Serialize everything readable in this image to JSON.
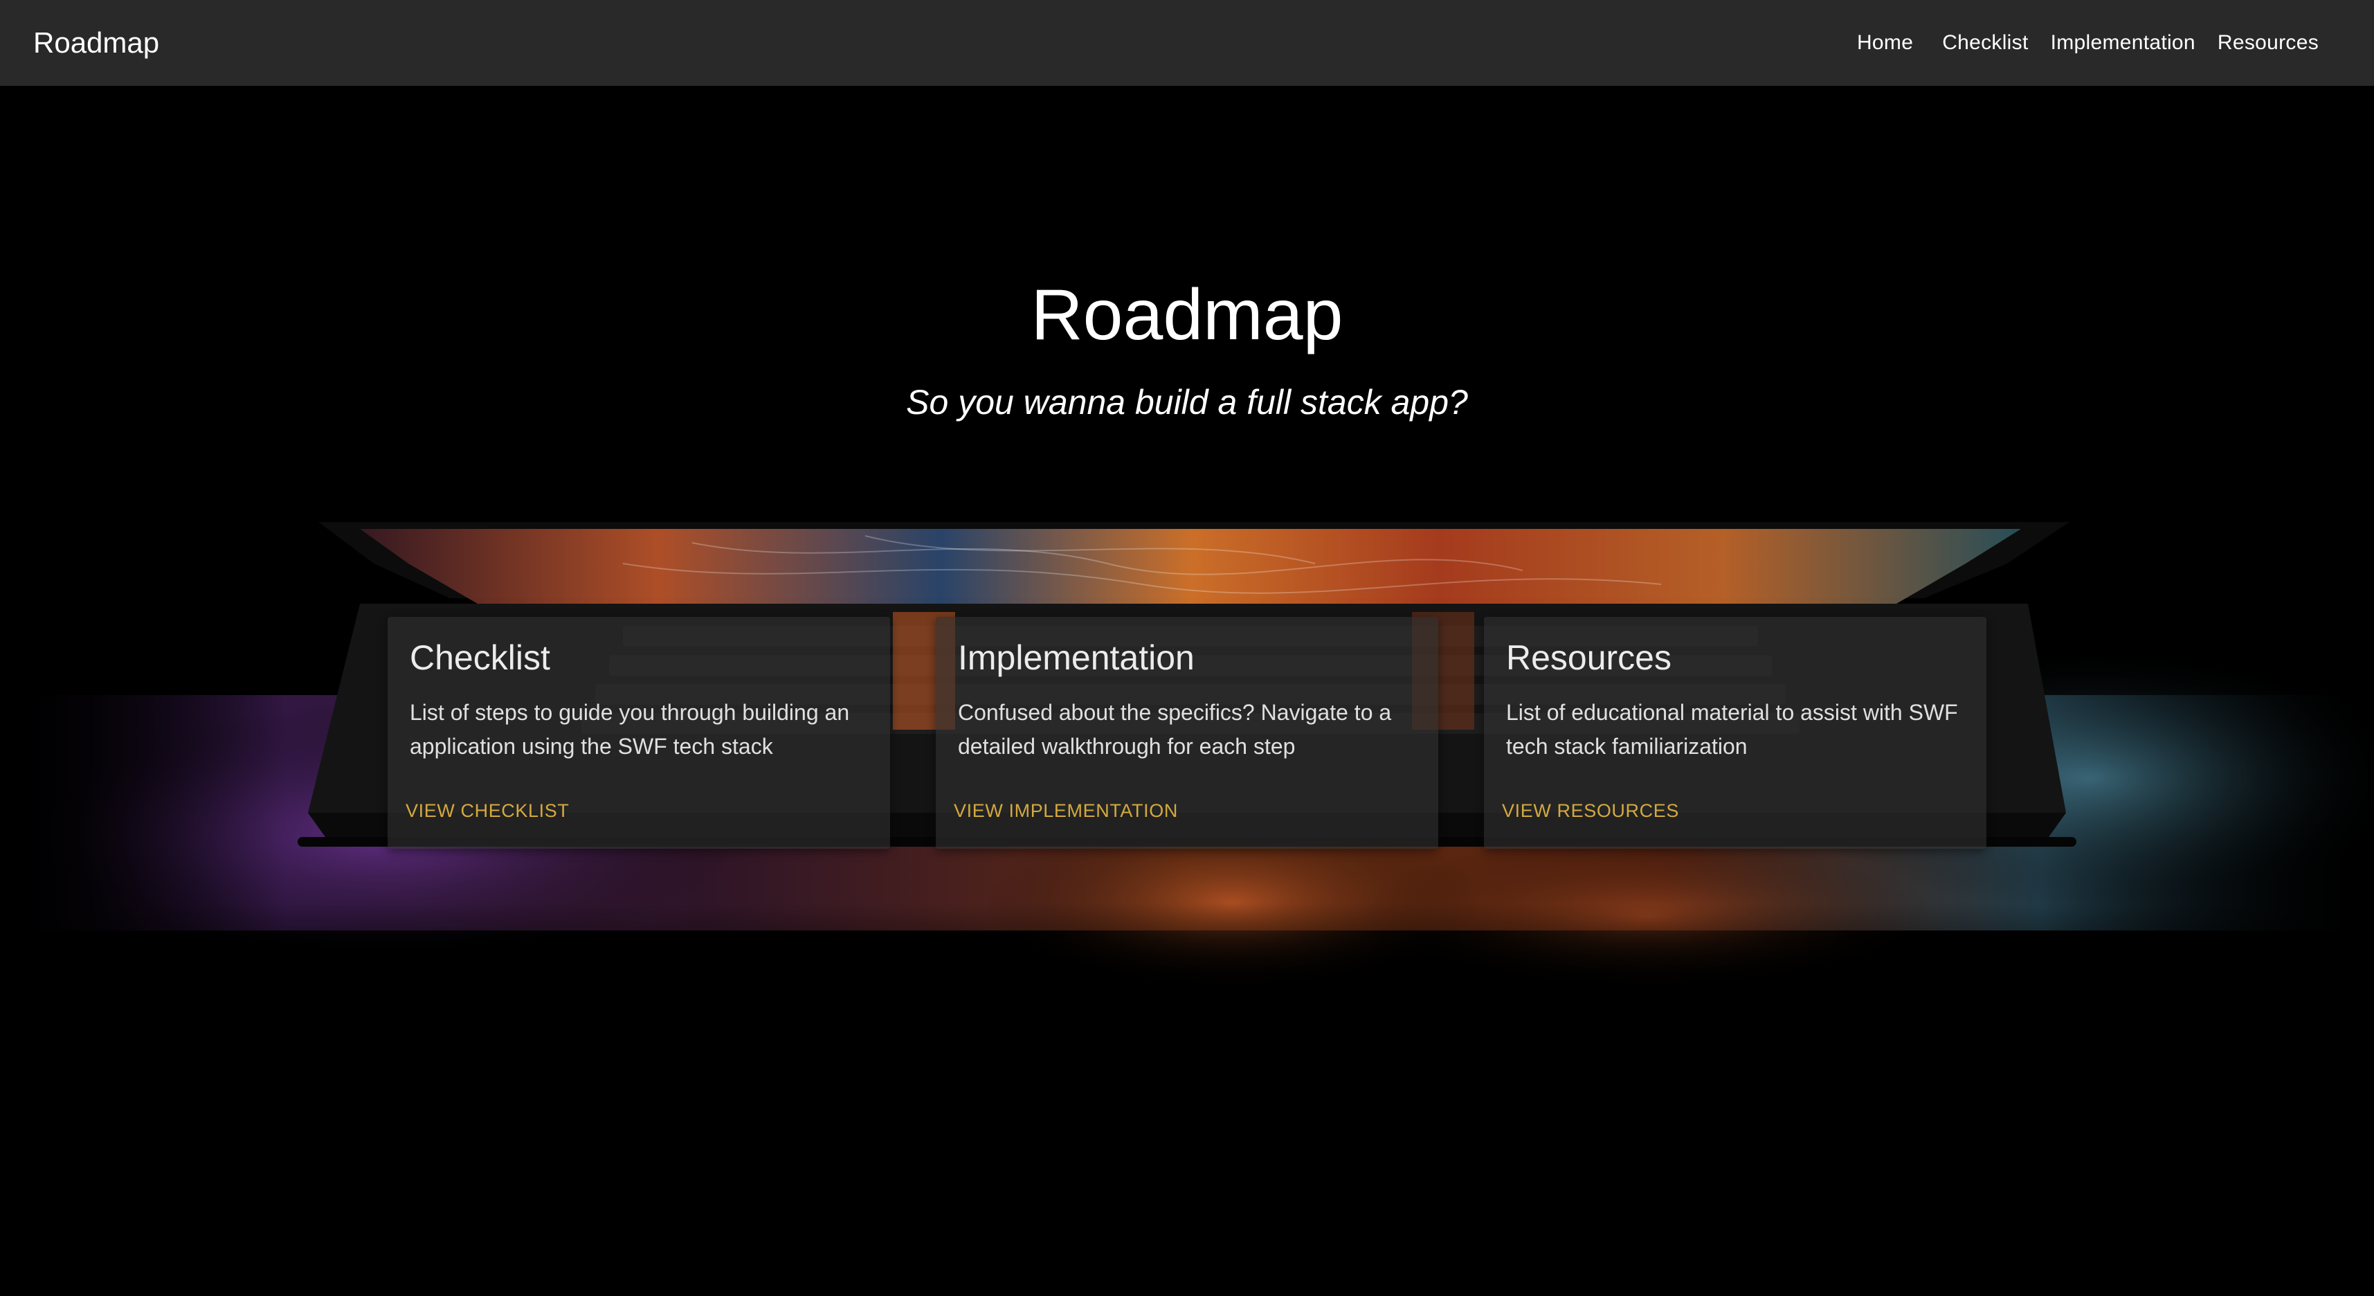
{
  "navbar": {
    "brand": "Roadmap",
    "links": [
      {
        "label": "Home"
      },
      {
        "label": "Checklist"
      },
      {
        "label": "Implementation"
      },
      {
        "label": "Resources"
      }
    ]
  },
  "hero": {
    "title": "Roadmap",
    "subtitle": "So you wanna build a full stack app?"
  },
  "cards": [
    {
      "title": "Checklist",
      "description": "List of steps to guide you through building an application using the SWF tech stack",
      "action": "VIEW CHECKLIST"
    },
    {
      "title": "Implementation",
      "description": "Confused about the specifics? Navigate to a detailed walkthrough for each step",
      "action": "VIEW IMPLEMENTATION"
    },
    {
      "title": "Resources",
      "description": "List of educational material to assist with SWF tech stack familiarization",
      "action": "VIEW RESOURCES"
    }
  ],
  "colors": {
    "navbar_bg": "#292929",
    "page_bg": "#000000",
    "link_accent": "#d4a93f"
  }
}
